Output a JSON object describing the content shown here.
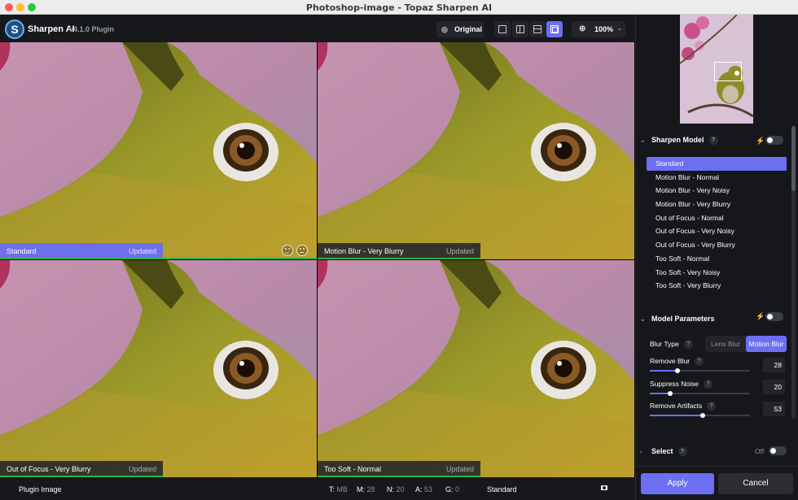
{
  "window": {
    "title": "Photoshop-image - Topaz Sharpen AI"
  },
  "app": {
    "name": "Sharpen AI",
    "version": "v4.1.0 Plugin",
    "logo_letter": "S"
  },
  "toolbar": {
    "original_label": "Original",
    "zoom_label": "100%",
    "active_view": "quad"
  },
  "panes": [
    {
      "name": "Standard",
      "status": "Updated",
      "selected": true
    },
    {
      "name": "Motion Blur - Very Blurry",
      "status": "Updated",
      "selected": false
    },
    {
      "name": "Out of Focus - Very Blurry",
      "status": "Updated",
      "selected": false
    },
    {
      "name": "Too Soft - Normal",
      "status": "Updated",
      "selected": false
    }
  ],
  "statusbar": {
    "label": "Plugin Image",
    "t_key": "T:",
    "t_val": "MB",
    "m_key": "M:",
    "m_val": "28",
    "n_key": "N:",
    "n_val": "20",
    "a_key": "A:",
    "a_val": "53",
    "g_key": "G:",
    "g_val": "0",
    "model": "Standard"
  },
  "sharpen_model": {
    "title": "Sharpen Model",
    "help": "?",
    "enabled": false,
    "items": [
      "Standard",
      "Motion Blur - Normal",
      "Motion Blur - Very Noisy",
      "Motion Blur - Very Blurry",
      "Out of Focus - Normal",
      "Out of Focus - Very Noisy",
      "Out of Focus - Very Blurry",
      "Too Soft - Normal",
      "Too Soft - Very Noisy",
      "Too Soft - Very Blurry"
    ],
    "selected": "Standard"
  },
  "model_parameters": {
    "title": "Model Parameters",
    "enabled": false,
    "blur_type_label": "Blur Type",
    "blur_options": [
      "Lens Blur",
      "Motion Blur"
    ],
    "blur_selected": "Motion Blur",
    "remove_blur_label": "Remove Blur",
    "remove_blur": "28",
    "suppress_noise_label": "Suppress Noise",
    "suppress_noise": "20",
    "remove_artifacts_label": "Remove Artifacts",
    "remove_artifacts": "53"
  },
  "select": {
    "title": "Select",
    "state": "Off"
  },
  "buttons": {
    "apply": "Apply",
    "cancel": "Cancel"
  },
  "colors": {
    "accent": "#6c6ff2",
    "progress": "#25b24a",
    "bird": "#8a8a25",
    "background": "#bd8aa5"
  }
}
